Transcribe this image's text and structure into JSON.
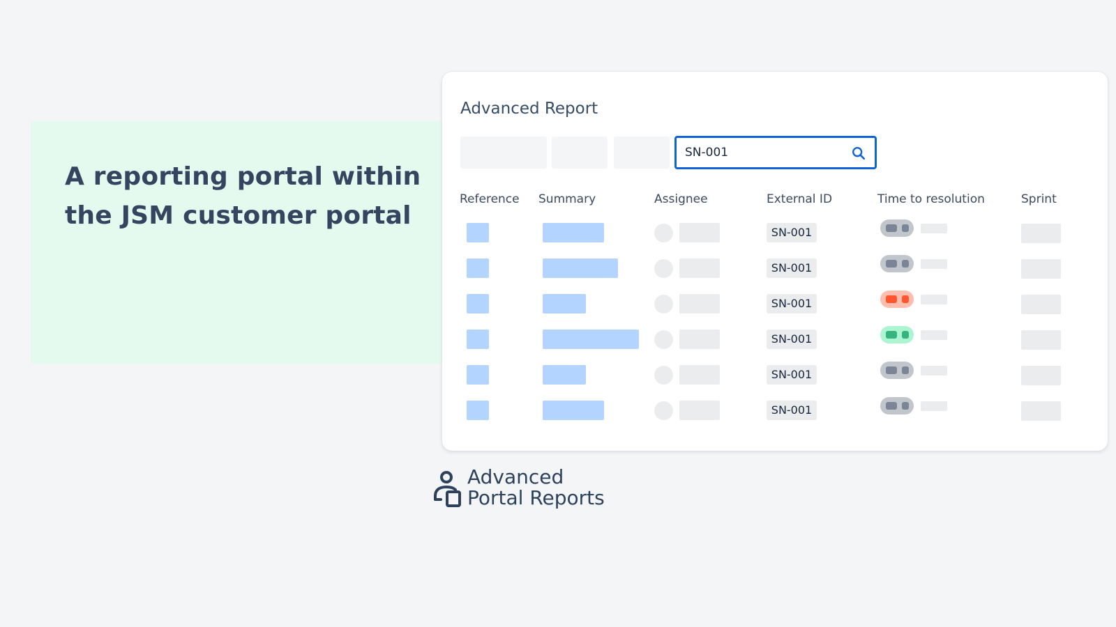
{
  "hero": {
    "line1": "A reporting portal within",
    "line2": "the JSM customer portal"
  },
  "report": {
    "title": "Advanced Report",
    "search": {
      "value": "SN-001",
      "placeholder": ""
    },
    "columns": [
      "Reference",
      "Summary",
      "Assignee",
      "External ID",
      "Time to resolution",
      "Sprint"
    ],
    "rows": [
      {
        "external_id": "SN-001",
        "status": "grey"
      },
      {
        "external_id": "SN-001",
        "status": "grey"
      },
      {
        "external_id": "SN-001",
        "status": "red"
      },
      {
        "external_id": "SN-001",
        "status": "green"
      },
      {
        "external_id": "SN-001",
        "status": "grey"
      },
      {
        "external_id": "SN-001",
        "status": "grey"
      }
    ]
  },
  "brand": {
    "line1": "Advanced",
    "line2": "Portal Reports",
    "icon": "user-on-device-icon"
  },
  "colors": {
    "accent": "#0f63d6",
    "placeholder_blue": "#b3d4ff",
    "status_grey": "#c1c5cc",
    "status_red": "#ff5630",
    "status_green": "#36b37e",
    "hero_bg": "#e4faef"
  }
}
